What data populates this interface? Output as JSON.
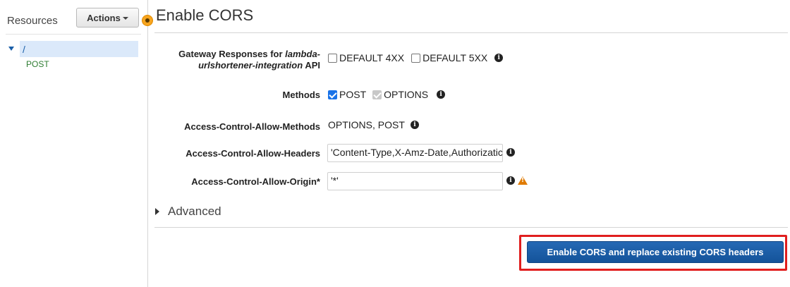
{
  "sidebar": {
    "resources_label": "Resources",
    "actions_label": "Actions",
    "root_resource": "/",
    "method": "POST"
  },
  "main": {
    "title": "Enable CORS",
    "gateway_label_prefix": "Gateway Responses for ",
    "gateway_label_api_name": "lambda-urlshortener-integration",
    "gateway_label_suffix": " API",
    "gateway_options": [
      {
        "label": "DEFAULT 4XX",
        "checked": false
      },
      {
        "label": "DEFAULT 5XX",
        "checked": false
      }
    ],
    "methods_label": "Methods",
    "methods": [
      {
        "label": "POST",
        "checked": true,
        "disabled": false
      },
      {
        "label": "OPTIONS",
        "checked": true,
        "disabled": true
      }
    ],
    "allow_methods_label": "Access-Control-Allow-Methods",
    "allow_methods_value": "OPTIONS, POST",
    "allow_headers_label": "Access-Control-Allow-Headers",
    "allow_headers_value": "'Content-Type,X-Amz-Date,Authorizatic",
    "allow_origin_label": "Access-Control-Allow-Origin*",
    "allow_origin_value": "'*'",
    "advanced_label": "Advanced",
    "enable_button_label": "Enable CORS and replace existing CORS headers"
  },
  "colors": {
    "primary_button": "#14539a",
    "highlight_border": "#e01e1e",
    "warning": "#e07b00",
    "selected_resource_bg": "#dbe9fa"
  },
  "icons": [
    "info-icon",
    "warning-icon",
    "caret-down-icon",
    "caret-right-icon",
    "tour-hotspot-icon"
  ]
}
